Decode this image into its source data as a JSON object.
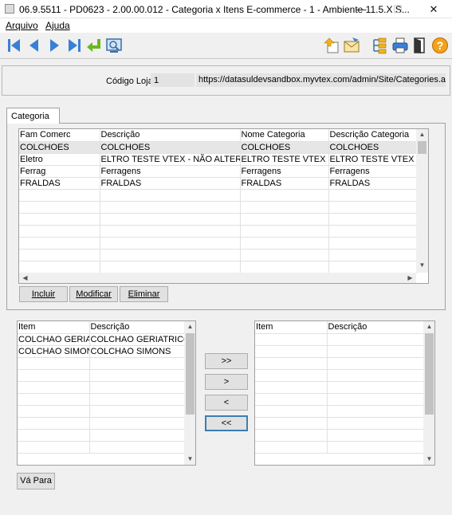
{
  "window": {
    "title": "06.9.5511 - PD0623 - 2.00.00.012 - Categoria x Itens E-commerce - 1 - Ambiente 11.5.X S...",
    "min": "—",
    "max": "☐",
    "close": "✕"
  },
  "menu": {
    "arquivo": "Arquivo",
    "ajuda": "Ajuda"
  },
  "header": {
    "loja_label": "Código Loja:",
    "loja_value": "1",
    "url": "https://datasuldevsandbox.myvtex.com/admin/Site/Categories.aspx?"
  },
  "tab": {
    "label": "Categoria"
  },
  "categorias": {
    "columns": [
      "Fam Comerc",
      "Descrição",
      "Nome Categoria",
      "Descrição Categoria"
    ],
    "rows": [
      [
        "COLCHOES",
        "COLCHOES",
        "COLCHOES",
        "COLCHOES"
      ],
      [
        "Eletro",
        "ELTRO TESTE VTEX - NÃO ALTERAR",
        "ELTRO TESTE VTEX - NÃO ALTERAR",
        "ELTRO TESTE VTEX - NÃO ALTERAR"
      ],
      [
        "Ferrag",
        "Ferragens",
        "Ferragens",
        "Ferragens"
      ],
      [
        "FRALDAS",
        "FRALDAS",
        "FRALDAS",
        "FRALDAS"
      ]
    ],
    "buttons": {
      "incluir": "Incluir",
      "modificar": "Modificar",
      "eliminar": "Eliminar"
    }
  },
  "itens_disponiveis": {
    "columns": [
      "Item",
      "Descrição"
    ],
    "rows": [
      [
        "COLCHAO GERIATRICO",
        "COLCHAO GERIATRICO"
      ],
      [
        "COLCHAO SIMONS",
        "COLCHAO SIMONS"
      ]
    ]
  },
  "itens_selecionados": {
    "columns": [
      "Item",
      "Descrição"
    ],
    "rows": []
  },
  "move_buttons": {
    "add_all": ">>",
    "add": ">",
    "remove": "<",
    "remove_all": "<<"
  },
  "vapara": "Vá Para",
  "icons": [
    "first-record-icon",
    "previous-record-icon",
    "next-record-icon",
    "last-record-icon",
    "return-icon",
    "zoom-icon",
    "export-icon",
    "email-icon",
    "tree-icon",
    "print-icon",
    "exit-icon",
    "help-icon"
  ]
}
